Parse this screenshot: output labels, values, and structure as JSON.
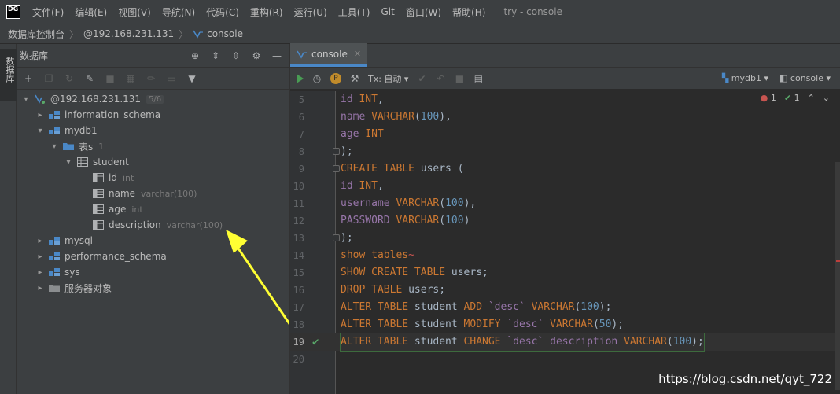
{
  "menu": {
    "logo": "DG",
    "items": [
      "文件(F)",
      "编辑(E)",
      "视图(V)",
      "导航(N)",
      "代码(C)",
      "重构(R)",
      "运行(U)",
      "工具(T)",
      "Git",
      "窗口(W)",
      "帮助(H)"
    ],
    "window_title": "try - console"
  },
  "breadcrumb": {
    "root": "数据库控制台",
    "host": "@192.168.231.131",
    "console": "console"
  },
  "sidetool": {
    "label": "数据库"
  },
  "db_panel": {
    "title": "数据库",
    "tree": {
      "datasource": "@192.168.231.131",
      "datasource_badge": "5/6",
      "schemas": {
        "information_schema": "information_schema",
        "mydb1": "mydb1",
        "tables_folder": "表s",
        "tables_count": "1",
        "table": "student",
        "columns": [
          {
            "name": "id",
            "type": "int"
          },
          {
            "name": "name",
            "type": "varchar(100)"
          },
          {
            "name": "age",
            "type": "int"
          },
          {
            "name": "description",
            "type": "varchar(100)"
          }
        ],
        "mysql": "mysql",
        "performance_schema": "performance_schema",
        "sys": "sys",
        "server_objects": "服务器对象"
      }
    }
  },
  "editor": {
    "tab_label": "console",
    "tx_label": "Tx: 自动",
    "schema_selector": "mydb1",
    "session_selector": "console",
    "error_count": "1",
    "ok_count": "1",
    "lines": [
      {
        "n": "5",
        "text": "id INT,"
      },
      {
        "n": "6",
        "text": "name VARCHAR(100),"
      },
      {
        "n": "7",
        "text": "age INT"
      },
      {
        "n": "8",
        "text": ");"
      },
      {
        "n": "9",
        "text": "CREATE TABLE users ("
      },
      {
        "n": "10",
        "text": "id INT,"
      },
      {
        "n": "11",
        "text": "username VARCHAR(100),"
      },
      {
        "n": "12",
        "text": "PASSWORD VARCHAR(100)"
      },
      {
        "n": "13",
        "text": ");"
      },
      {
        "n": "14",
        "text": "show tables"
      },
      {
        "n": "15",
        "text": "SHOW CREATE TABLE users;"
      },
      {
        "n": "16",
        "text": "DROP TABLE users;"
      },
      {
        "n": "17",
        "text": "ALTER TABLE student ADD `desc` VARCHAR(100);"
      },
      {
        "n": "18",
        "text": "ALTER TABLE student MODIFY `desc` VARCHAR(50);"
      },
      {
        "n": "19",
        "text": "ALTER TABLE student CHANGE `desc` description VARCHAR(100);"
      },
      {
        "n": "20",
        "text": ""
      }
    ]
  },
  "watermark": "https://blog.csdn.net/qyt_722",
  "colors": {
    "keyword": "#cc7832",
    "number": "#6897bb",
    "column": "#9876aa",
    "function": "#ffc66d",
    "arrow": "#ffff33",
    "ok_check": "#59a869",
    "error": "#c75450"
  }
}
